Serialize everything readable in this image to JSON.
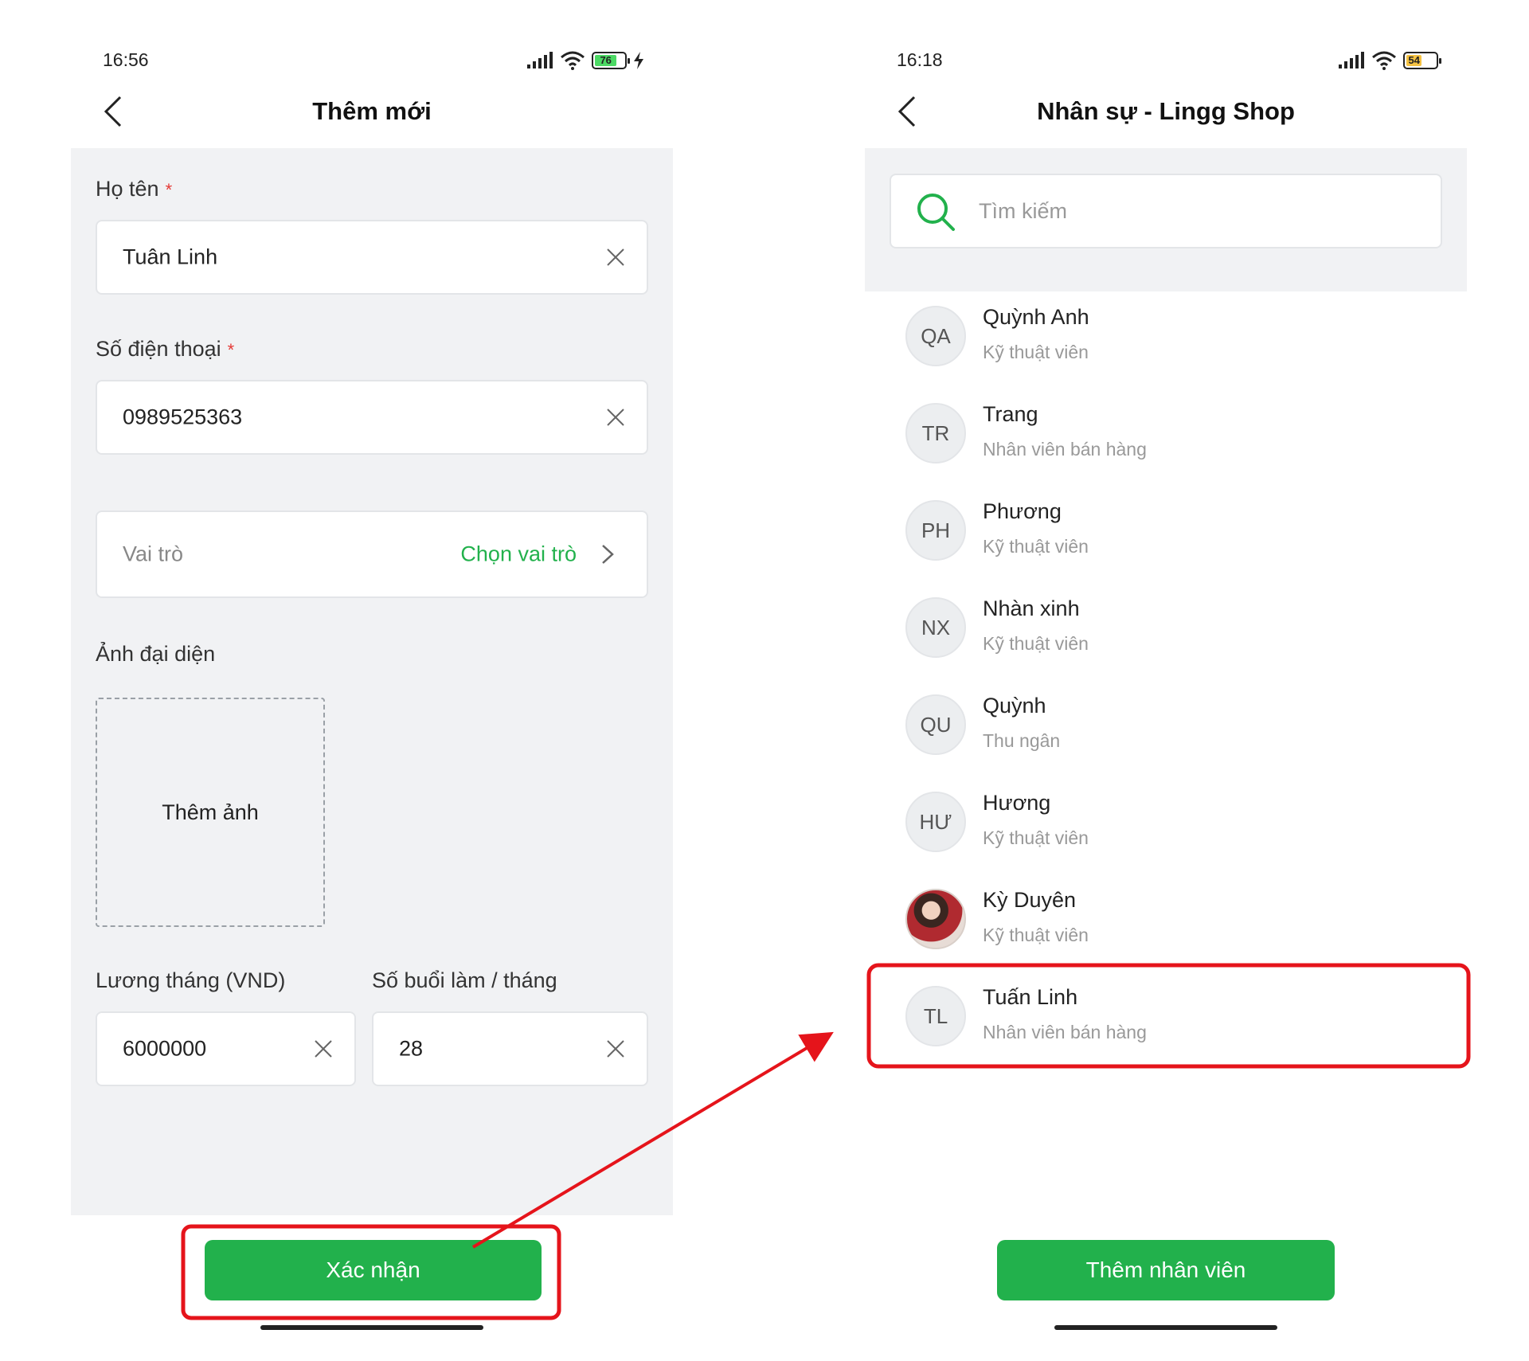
{
  "left_screen": {
    "status": {
      "time": "16:56",
      "battery": "76"
    },
    "nav": {
      "title": "Thêm mới"
    },
    "fields": {
      "name": {
        "label": "Họ tên",
        "required_mark": "*",
        "value": "Tuân Linh"
      },
      "phone": {
        "label": "Số điện thoại",
        "required_mark": "*",
        "value": "0989525363"
      },
      "role": {
        "label": "Vai trò",
        "action": "Chọn vai trò"
      },
      "avatar": {
        "label": "Ảnh đại diện",
        "add_photo": "Thêm ảnh"
      },
      "salary": {
        "label": "Lương tháng (VND)",
        "value": "6000000"
      },
      "sessions": {
        "label": "Số buổi làm / tháng",
        "value": "28"
      }
    },
    "confirm_button": "Xác nhận"
  },
  "right_screen": {
    "status": {
      "time": "16:18",
      "battery": "54"
    },
    "nav": {
      "title": "Nhân sự - Lingg Shop"
    },
    "search": {
      "placeholder": "Tìm kiếm"
    },
    "staff": [
      {
        "initials": "QA",
        "name": "Quỳnh Anh",
        "role": "Kỹ thuật viên"
      },
      {
        "initials": "TR",
        "name": "Trang",
        "role": "Nhân viên bán hàng"
      },
      {
        "initials": "PH",
        "name": "Phương",
        "role": "Kỹ thuật viên"
      },
      {
        "initials": "NX",
        "name": "Nhàn xinh",
        "role": "Kỹ thuật viên"
      },
      {
        "initials": "QU",
        "name": "Quỳnh",
        "role": "Thu ngân"
      },
      {
        "initials": "HƯ",
        "name": "Hương",
        "role": "Kỹ thuật viên"
      },
      {
        "initials": "",
        "name": "Kỳ Duyên",
        "role": "Kỹ thuật viên"
      },
      {
        "initials": "TL",
        "name": "Tuấn Linh",
        "role": "Nhân viên bán hàng"
      }
    ],
    "add_button": "Thêm nhân viên"
  },
  "colors": {
    "accent_green": "#22b14c",
    "highlight_red": "#e5141b",
    "battery_left": "#4cd964",
    "battery_right": "#f5c242"
  }
}
